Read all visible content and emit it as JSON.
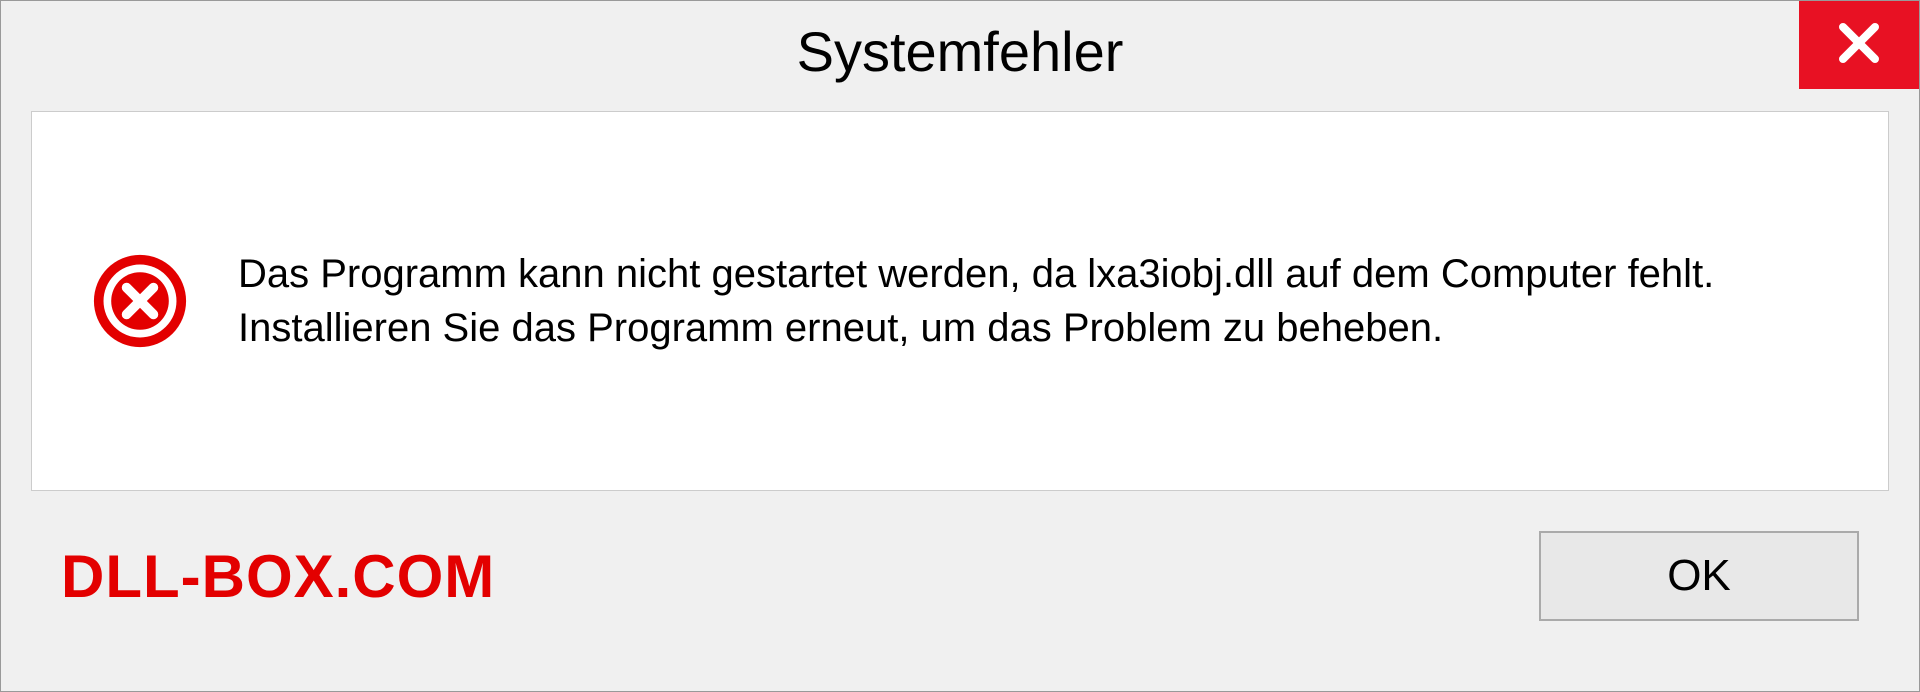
{
  "dialog": {
    "title": "Systemfehler",
    "message": "Das Programm kann nicht gestartet werden, da lxa3iobj.dll auf dem Computer fehlt. Installieren Sie das Programm erneut, um das Problem zu beheben.",
    "ok_label": "OK"
  },
  "watermark": "DLL-BOX.COM"
}
